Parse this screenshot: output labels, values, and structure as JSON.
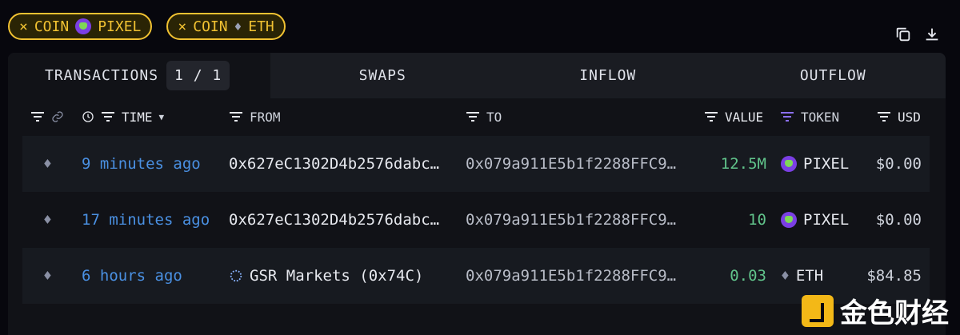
{
  "filters": [
    {
      "prefix": "×",
      "kind": "COIN",
      "icon": "pixel-logo",
      "value": "PIXEL"
    },
    {
      "prefix": "×",
      "kind": "COIN",
      "icon": "eth-icon",
      "value": "ETH"
    }
  ],
  "tabs": {
    "transactions": "TRANSACTIONS",
    "pager": "1 / 1",
    "swaps": "SWAPS",
    "inflow": "INFLOW",
    "outflow": "OUTFLOW"
  },
  "columns": {
    "time": "TIME",
    "from": "FROM",
    "to": "TO",
    "value": "VALUE",
    "token": "TOKEN",
    "usd": "USD"
  },
  "rows": [
    {
      "chain": "eth",
      "time": "9 minutes ago",
      "from": "0x627eC1302D4b2576dabc…",
      "to": "0x079a911E5b1f2288FFC9…",
      "value": "12.5M",
      "token": "PIXEL",
      "usd": "$0.00"
    },
    {
      "chain": "eth",
      "time": "17 minutes ago",
      "from": "0x627eC1302D4b2576dabc…",
      "to": "0x079a911E5b1f2288FFC9…",
      "value": "10",
      "token": "PIXEL",
      "usd": "$0.00"
    },
    {
      "chain": "eth",
      "time": "6 hours ago",
      "from": "GSR Markets (0x74C)",
      "to": "0x079a911E5b1f2288FFC9…",
      "value": "0.03",
      "token": "ETH",
      "usd": "$84.85"
    }
  ],
  "watermark": "金色财经",
  "colors": {
    "accent": "#f1c232",
    "time": "#4a90e2",
    "value": "#61c48b"
  }
}
